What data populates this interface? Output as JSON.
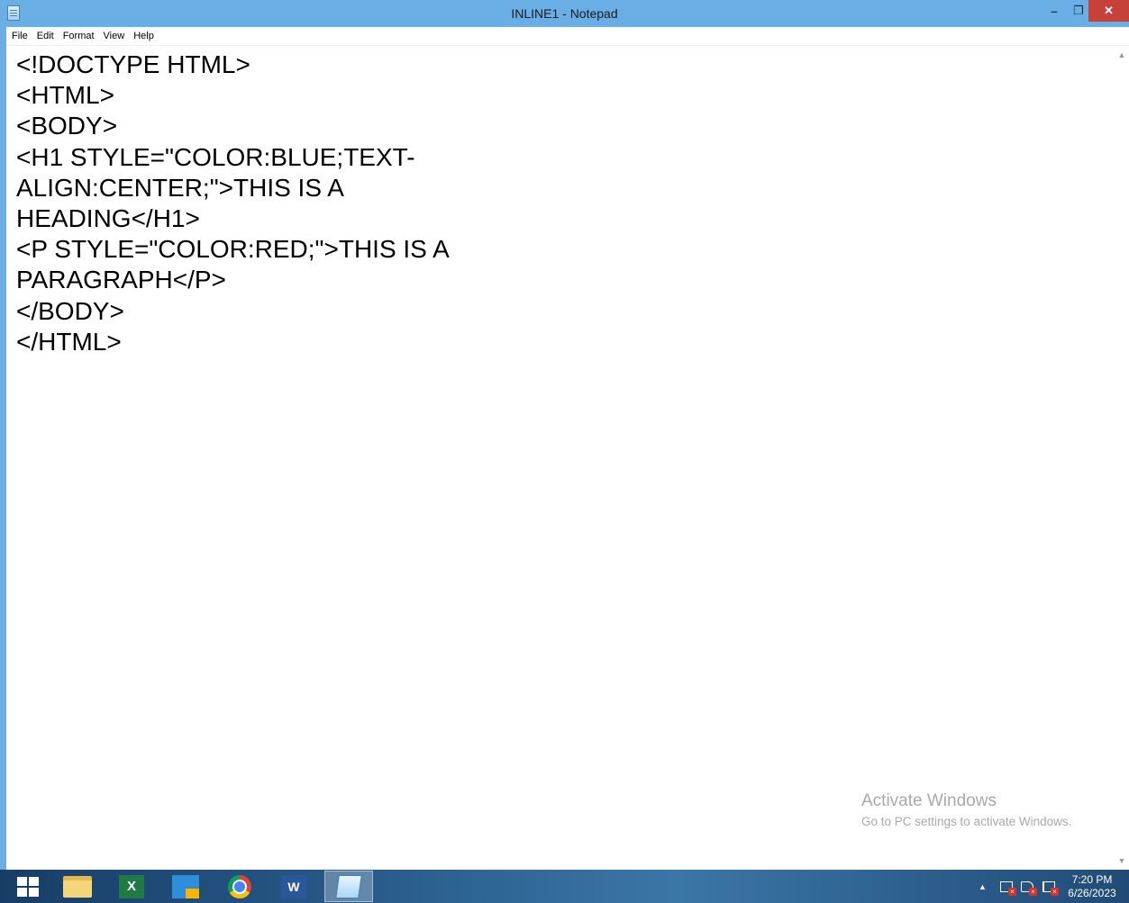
{
  "window": {
    "title": "INLINE1 - Notepad",
    "minimize_glyph": "–",
    "maximize_glyph": "❐",
    "close_glyph": "✕"
  },
  "menu": {
    "items": [
      "File",
      "Edit",
      "Format",
      "View",
      "Help"
    ]
  },
  "editor": {
    "content": "<!DOCTYPE HTML>\n<HTML>\n<BODY>\n<H1 STYLE=\"COLOR:BLUE;TEXT-\nALIGN:CENTER;\">THIS IS A\nHEADING</H1>\n<P STYLE=\"COLOR:RED;\">THIS IS A\nPARAGRAPH</P>\n</BODY>\n</HTML>"
  },
  "watermark": {
    "title": "Activate Windows",
    "subtitle": "Go to PC settings to activate Windows."
  },
  "taskbar": {
    "apps": [
      {
        "name": "start-icon"
      },
      {
        "name": "file-explorer-icon"
      },
      {
        "name": "excel-icon",
        "glyph": "X"
      },
      {
        "name": "store-icon"
      },
      {
        "name": "chrome-icon"
      },
      {
        "name": "word-icon",
        "glyph": "W"
      },
      {
        "name": "notepad-icon",
        "active": true
      }
    ],
    "tray_arrow": "▲",
    "clock_time": "7:20 PM",
    "clock_date": "6/26/2023"
  },
  "colors": {
    "title_bar": "#6aaee6",
    "close_button": "#c7413a",
    "editor_bg": "#ffffff"
  }
}
